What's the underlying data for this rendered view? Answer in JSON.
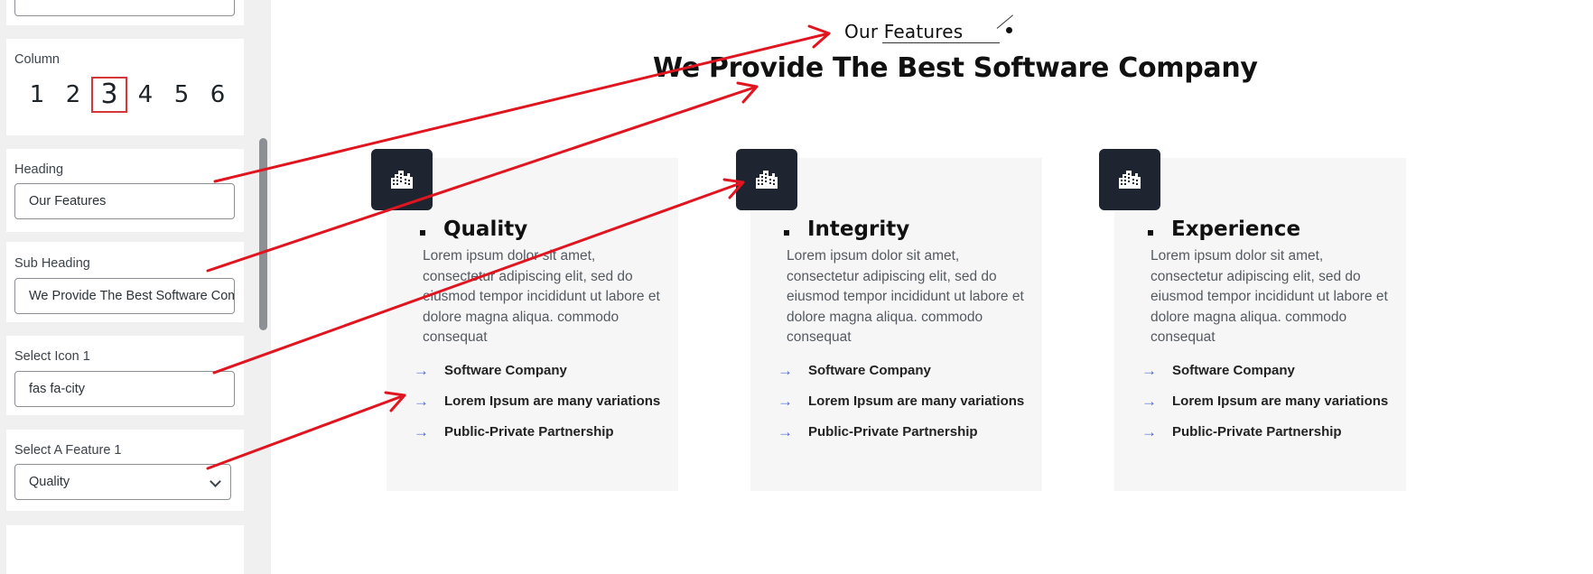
{
  "settings": {
    "column": {
      "label": "Column",
      "options": [
        "1",
        "2",
        "3",
        "4",
        "5",
        "6"
      ],
      "selected": "3"
    },
    "heading": {
      "label": "Heading",
      "value": "Our Features"
    },
    "sub_heading": {
      "label": "Sub Heading",
      "value": "We Provide The Best Software Company"
    },
    "select_icon_1": {
      "label": "Select Icon 1",
      "value": "fas fa-city"
    },
    "select_feature_1": {
      "label": "Select A Feature 1",
      "value": "Quality"
    }
  },
  "preview": {
    "heading": "Our Features",
    "sub_heading": "We Provide The Best Software Company",
    "features": [
      {
        "icon": "city-icon",
        "title": "Quality",
        "description": "Lorem ipsum dolor sit amet, consectetur adipiscing elit, sed do eiusmod tempor incididunt ut labore et dolore magna aliqua. commodo consequat",
        "items": [
          "Software Company",
          "Lorem Ipsum are many variations",
          "Public-Private Partnership"
        ]
      },
      {
        "icon": "city-icon",
        "title": "Integrity",
        "description": "Lorem ipsum dolor sit amet, consectetur adipiscing elit, sed do eiusmod tempor incididunt ut labore et dolore magna aliqua. commodo consequat",
        "items": [
          "Software Company",
          "Lorem Ipsum are many variations",
          "Public-Private Partnership"
        ]
      },
      {
        "icon": "city-icon",
        "title": "Experience",
        "description": "Lorem ipsum dolor sit amet, consectetur adipiscing elit, sed do eiusmod tempor incididunt ut labore et dolore magna aliqua. commodo consequat",
        "items": [
          "Software Company",
          "Lorem Ipsum are many variations",
          "Public-Private Partnership"
        ]
      }
    ]
  },
  "colors": {
    "annotation": "#e0151f",
    "icon_box": "#1e2530",
    "arrow": "#4f6bd3",
    "column_highlight": "#d63638"
  }
}
